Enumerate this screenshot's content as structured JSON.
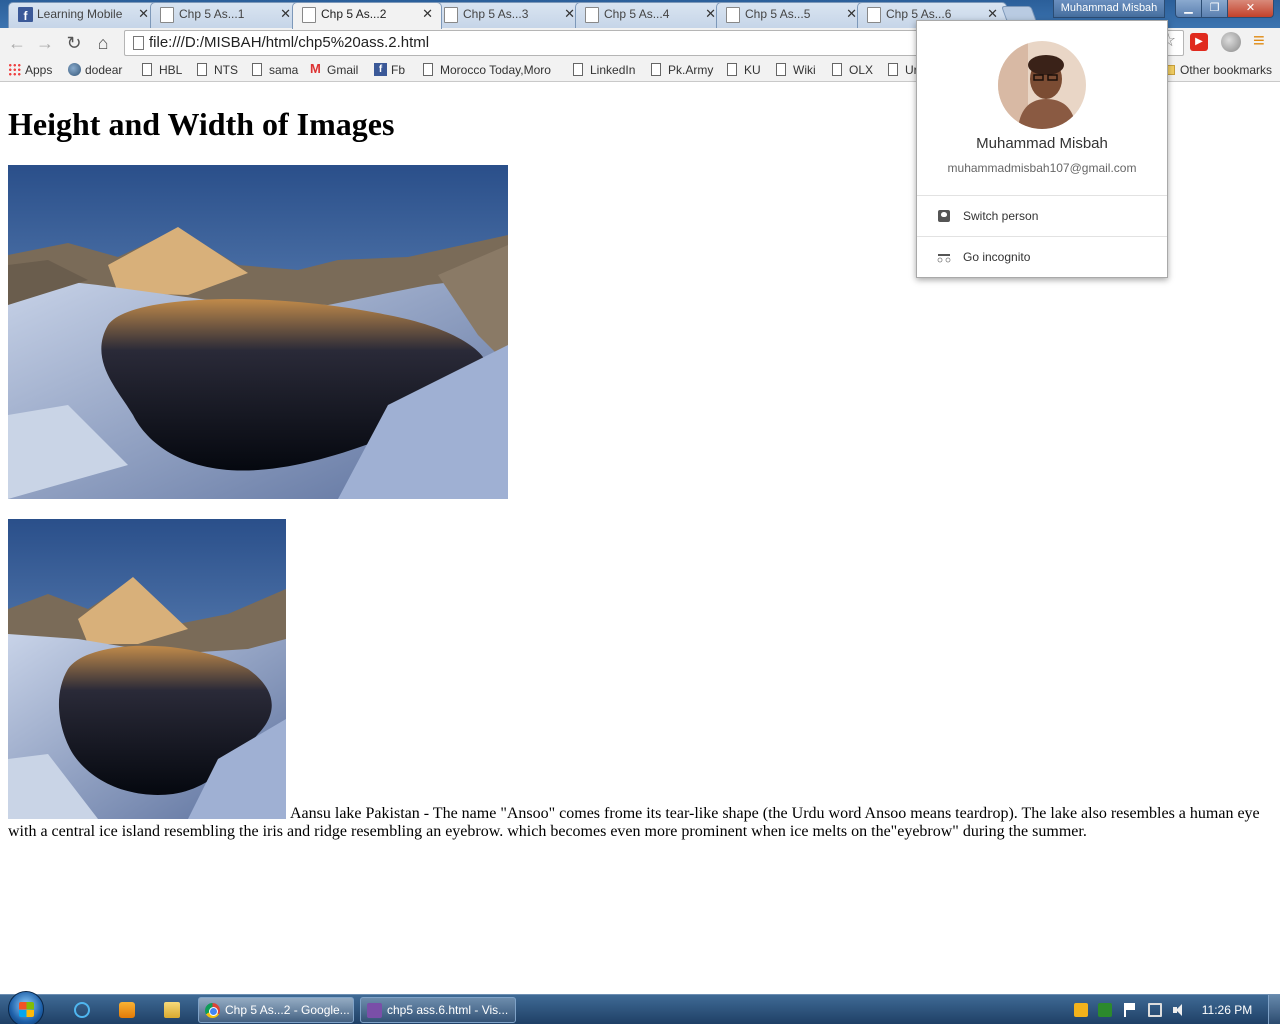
{
  "window": {
    "profile_button": "Muhammad Misbah"
  },
  "tabs": [
    {
      "title": "Learning Mobile",
      "active": false
    },
    {
      "title": "Chp 5 As...1",
      "active": false
    },
    {
      "title": "Chp 5 As...2",
      "active": true
    },
    {
      "title": "Chp 5 As...3",
      "active": false
    },
    {
      "title": "Chp 5 As...4",
      "active": false
    },
    {
      "title": "Chp 5 As...5",
      "active": false
    },
    {
      "title": "Chp 5 As...6",
      "active": false
    }
  ],
  "toolbar": {
    "url": "file:///D:/MISBAH/html/chp5%20ass.2.html"
  },
  "bookmarks": [
    {
      "label": "Apps",
      "icon": "apps-icon"
    },
    {
      "label": "dodear",
      "icon": "globe-icon"
    },
    {
      "label": "HBL",
      "icon": "page-icon"
    },
    {
      "label": "NTS",
      "icon": "page-icon"
    },
    {
      "label": "sama",
      "icon": "page-icon"
    },
    {
      "label": "Gmail",
      "icon": "gmail-icon"
    },
    {
      "label": "Fb",
      "icon": "facebook-icon"
    },
    {
      "label": "Morocco Today,Moro",
      "icon": "page-icon"
    },
    {
      "label": "LinkedIn",
      "icon": "page-icon"
    },
    {
      "label": "Pk.Army",
      "icon": "page-icon"
    },
    {
      "label": "KU",
      "icon": "page-icon"
    },
    {
      "label": "Wiki",
      "icon": "page-icon"
    },
    {
      "label": "OLX",
      "icon": "page-icon"
    },
    {
      "label": "Ur",
      "icon": "page-icon"
    }
  ],
  "other_bookmarks": "Other bookmarks",
  "page": {
    "title": "Height and Width of Images",
    "caption": "Aansu lake Pakistan - The name \"Ansoo\" comes frome its tear-like shape (the Urdu word Ansoo means teardrop). The lake also resembles a human eye with a central ice island resembling the iris and ridge resembling an eyebrow. which becomes even more prominent when ice melts on the\"eyebrow\" during the summer."
  },
  "profile_popup": {
    "name": "Muhammad Misbah",
    "email": "muhammadmisbah107@gmail.com",
    "switch_person": "Switch person",
    "go_incognito": "Go incognito"
  },
  "taskbar": {
    "tasks": [
      {
        "label": "Chp 5 As...2 - Google...",
        "icon": "chrome-icon"
      },
      {
        "label": "chp5 ass.6.html - Vis...",
        "icon": "visual-studio-icon"
      }
    ],
    "clock": "11:26 PM"
  },
  "colors": {
    "tabstrip": "#3c74b0",
    "chrome_toolbar": "#f2f2f2",
    "taskbar": "#1f4066"
  }
}
